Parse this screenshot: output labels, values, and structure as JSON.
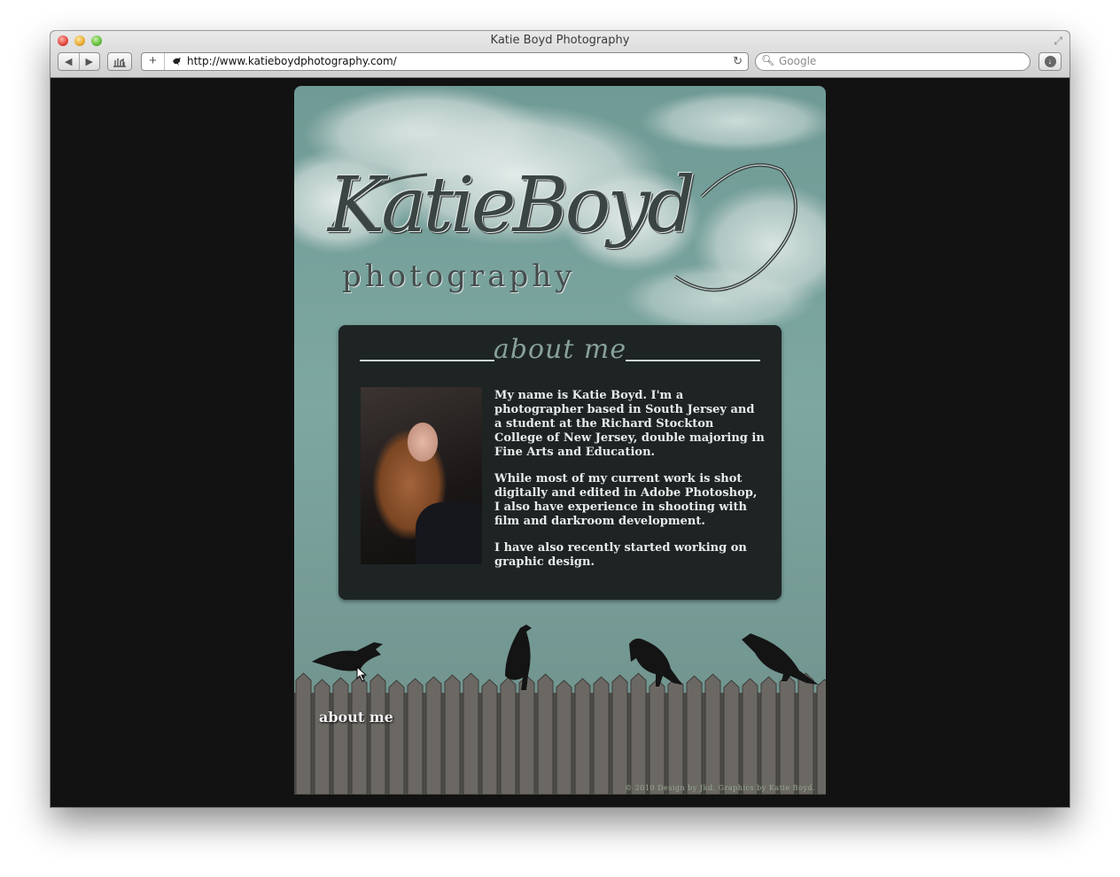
{
  "browser": {
    "window_title": "Katie Boyd Photography",
    "url": "http://www.katieboydphotography.com/",
    "search_placeholder": "Google",
    "back_glyph": "◀",
    "forward_glyph": "▶",
    "new_tab_glyph": "+",
    "reload_glyph": "↻",
    "resize_glyph": "⤢",
    "search_glyph": "🔍︎",
    "download_glyph": "↓"
  },
  "site": {
    "logo_main": "KatieBoyd",
    "logo_sub": "photography",
    "about": {
      "title": "about me",
      "paragraphs": [
        "My name is Katie Boyd. I'm a photographer based in South Jersey and a student at the Richard Stockton College of New Jersey, double majoring in Fine Arts and Education.",
        "While most of my current work is shot digitally and edited in Adobe Photoshop, I also have experience in shooting with film and darkroom development.",
        "I have also recently started working on graphic design."
      ]
    },
    "nav": {
      "about_label": "about me"
    },
    "footer": "© 2010 Design by Jkd. Graphics by Katie Boyd."
  },
  "colors": {
    "page_bg": "#121212",
    "sky": "#7ea7a1",
    "panel": "#1e2424",
    "panel_title": "#88a09c",
    "body_text": "#e6ecea"
  },
  "icons": [
    "back-arrow-icon",
    "forward-arrow-icon",
    "bookmarks-icon",
    "new-tab-icon",
    "favicon-icon",
    "reload-icon",
    "search-icon",
    "download-icon",
    "resize-icon",
    "crow-icon"
  ]
}
